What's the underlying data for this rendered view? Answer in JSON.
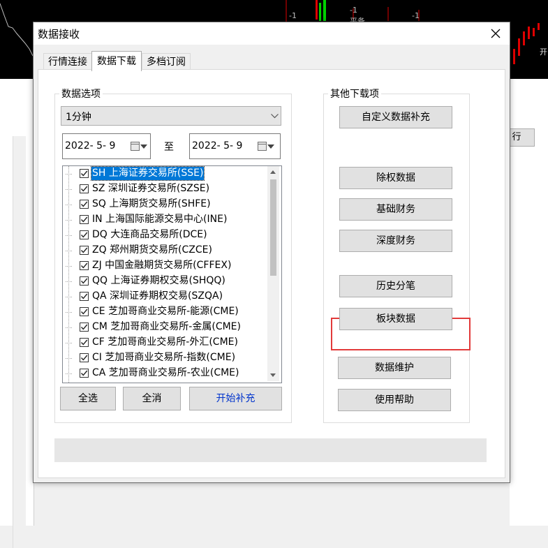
{
  "background_app": {
    "chart_labels": [
      "-1",
      "-1",
      "平备",
      "-1",
      "开"
    ],
    "right_button_label": "行"
  },
  "dialog": {
    "title": "数据接收",
    "tabs": [
      {
        "label": "行情连接",
        "active": false
      },
      {
        "label": "数据下载",
        "active": true
      },
      {
        "label": "多档订阅",
        "active": false
      }
    ],
    "data_options": {
      "group_title": "数据选项",
      "period_value": "1分钟",
      "start_date": "2022- 5- 9",
      "date_separator": "至",
      "end_date": "2022- 5- 9",
      "exchanges": [
        {
          "label": "SH 上海证券交易所(SSE)",
          "checked": true,
          "selected": true
        },
        {
          "label": "SZ 深圳证券交易所(SZSE)",
          "checked": true,
          "selected": false
        },
        {
          "label": "SQ 上海期货交易所(SHFE)",
          "checked": true,
          "selected": false
        },
        {
          "label": "IN 上海国际能源交易中心(INE)",
          "checked": true,
          "selected": false
        },
        {
          "label": "DQ 大连商品交易所(DCE)",
          "checked": true,
          "selected": false
        },
        {
          "label": "ZQ 郑州期货交易所(CZCE)",
          "checked": true,
          "selected": false
        },
        {
          "label": "ZJ 中国金融期货交易所(CFFEX)",
          "checked": true,
          "selected": false
        },
        {
          "label": "QQ 上海证券期权交易(SHQQ)",
          "checked": true,
          "selected": false
        },
        {
          "label": "QA 深圳证券期权交易(SZQA)",
          "checked": true,
          "selected": false
        },
        {
          "label": "CE 芝加哥商业交易所-能源(CME)",
          "checked": true,
          "selected": false
        },
        {
          "label": "CM 芝加哥商业交易所-金属(CME)",
          "checked": true,
          "selected": false
        },
        {
          "label": "CF 芝加哥商业交易所-外汇(CME)",
          "checked": true,
          "selected": false
        },
        {
          "label": "CI 芝加哥商业交易所-指数(CME)",
          "checked": true,
          "selected": false
        },
        {
          "label": "CA 芝加哥商业交易所-农业(CME)",
          "checked": true,
          "selected": false
        }
      ],
      "select_all_label": "全选",
      "deselect_all_label": "全消",
      "start_fill_label": "开始补充"
    },
    "other_downloads": {
      "group_title": "其他下载项",
      "custom_fill_label": "自定义数据补充",
      "ex_rights_label": "除权数据",
      "basic_finance_label": "基础财务",
      "deep_finance_label": "深度财务",
      "history_tick_label": "历史分笔",
      "sector_data_label": "板块数据",
      "data_maintenance_label": "数据维护",
      "help_label": "使用帮助"
    },
    "status_text": ""
  },
  "colors": {
    "selection": "#0078d7",
    "highlight_box": "#e23a3a"
  }
}
